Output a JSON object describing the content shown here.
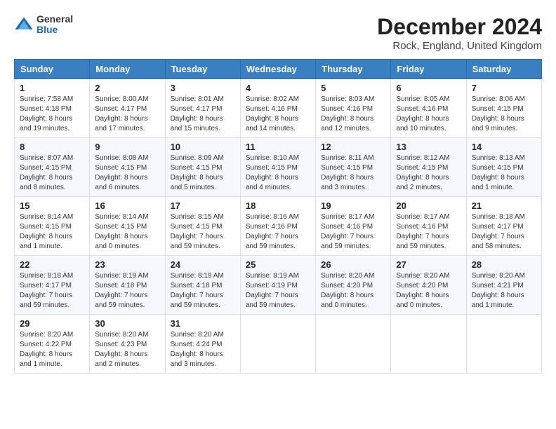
{
  "header": {
    "logo_general": "General",
    "logo_blue": "Blue",
    "month_title": "December 2024",
    "location": "Rock, England, United Kingdom"
  },
  "weekdays": [
    "Sunday",
    "Monday",
    "Tuesday",
    "Wednesday",
    "Thursday",
    "Friday",
    "Saturday"
  ],
  "weeks": [
    [
      {
        "day": "1",
        "info": "Sunrise: 7:58 AM\nSunset: 4:18 PM\nDaylight: 8 hours and 19 minutes."
      },
      {
        "day": "2",
        "info": "Sunrise: 8:00 AM\nSunset: 4:17 PM\nDaylight: 8 hours and 17 minutes."
      },
      {
        "day": "3",
        "info": "Sunrise: 8:01 AM\nSunset: 4:17 PM\nDaylight: 8 hours and 15 minutes."
      },
      {
        "day": "4",
        "info": "Sunrise: 8:02 AM\nSunset: 4:16 PM\nDaylight: 8 hours and 14 minutes."
      },
      {
        "day": "5",
        "info": "Sunrise: 8:03 AM\nSunset: 4:16 PM\nDaylight: 8 hours and 12 minutes."
      },
      {
        "day": "6",
        "info": "Sunrise: 8:05 AM\nSunset: 4:16 PM\nDaylight: 8 hours and 10 minutes."
      },
      {
        "day": "7",
        "info": "Sunrise: 8:06 AM\nSunset: 4:15 PM\nDaylight: 8 hours and 9 minutes."
      }
    ],
    [
      {
        "day": "8",
        "info": "Sunrise: 8:07 AM\nSunset: 4:15 PM\nDaylight: 8 hours and 8 minutes."
      },
      {
        "day": "9",
        "info": "Sunrise: 8:08 AM\nSunset: 4:15 PM\nDaylight: 8 hours and 6 minutes."
      },
      {
        "day": "10",
        "info": "Sunrise: 8:09 AM\nSunset: 4:15 PM\nDaylight: 8 hours and 5 minutes."
      },
      {
        "day": "11",
        "info": "Sunrise: 8:10 AM\nSunset: 4:15 PM\nDaylight: 8 hours and 4 minutes."
      },
      {
        "day": "12",
        "info": "Sunrise: 8:11 AM\nSunset: 4:15 PM\nDaylight: 8 hours and 3 minutes."
      },
      {
        "day": "13",
        "info": "Sunrise: 8:12 AM\nSunset: 4:15 PM\nDaylight: 8 hours and 2 minutes."
      },
      {
        "day": "14",
        "info": "Sunrise: 8:13 AM\nSunset: 4:15 PM\nDaylight: 8 hours and 1 minute."
      }
    ],
    [
      {
        "day": "15",
        "info": "Sunrise: 8:14 AM\nSunset: 4:15 PM\nDaylight: 8 hours and 1 minute."
      },
      {
        "day": "16",
        "info": "Sunrise: 8:14 AM\nSunset: 4:15 PM\nDaylight: 8 hours and 0 minutes."
      },
      {
        "day": "17",
        "info": "Sunrise: 8:15 AM\nSunset: 4:15 PM\nDaylight: 7 hours and 59 minutes."
      },
      {
        "day": "18",
        "info": "Sunrise: 8:16 AM\nSunset: 4:16 PM\nDaylight: 7 hours and 59 minutes."
      },
      {
        "day": "19",
        "info": "Sunrise: 8:17 AM\nSunset: 4:16 PM\nDaylight: 7 hours and 59 minutes."
      },
      {
        "day": "20",
        "info": "Sunrise: 8:17 AM\nSunset: 4:16 PM\nDaylight: 7 hours and 59 minutes."
      },
      {
        "day": "21",
        "info": "Sunrise: 8:18 AM\nSunset: 4:17 PM\nDaylight: 7 hours and 58 minutes."
      }
    ],
    [
      {
        "day": "22",
        "info": "Sunrise: 8:18 AM\nSunset: 4:17 PM\nDaylight: 7 hours and 59 minutes."
      },
      {
        "day": "23",
        "info": "Sunrise: 8:19 AM\nSunset: 4:18 PM\nDaylight: 7 hours and 59 minutes."
      },
      {
        "day": "24",
        "info": "Sunrise: 8:19 AM\nSunset: 4:18 PM\nDaylight: 7 hours and 59 minutes."
      },
      {
        "day": "25",
        "info": "Sunrise: 8:19 AM\nSunset: 4:19 PM\nDaylight: 7 hours and 59 minutes."
      },
      {
        "day": "26",
        "info": "Sunrise: 8:20 AM\nSunset: 4:20 PM\nDaylight: 8 hours and 0 minutes."
      },
      {
        "day": "27",
        "info": "Sunrise: 8:20 AM\nSunset: 4:20 PM\nDaylight: 8 hours and 0 minutes."
      },
      {
        "day": "28",
        "info": "Sunrise: 8:20 AM\nSunset: 4:21 PM\nDaylight: 8 hours and 1 minute."
      }
    ],
    [
      {
        "day": "29",
        "info": "Sunrise: 8:20 AM\nSunset: 4:22 PM\nDaylight: 8 hours and 1 minute."
      },
      {
        "day": "30",
        "info": "Sunrise: 8:20 AM\nSunset: 4:23 PM\nDaylight: 8 hours and 2 minutes."
      },
      {
        "day": "31",
        "info": "Sunrise: 8:20 AM\nSunset: 4:24 PM\nDaylight: 8 hours and 3 minutes."
      },
      null,
      null,
      null,
      null
    ]
  ]
}
